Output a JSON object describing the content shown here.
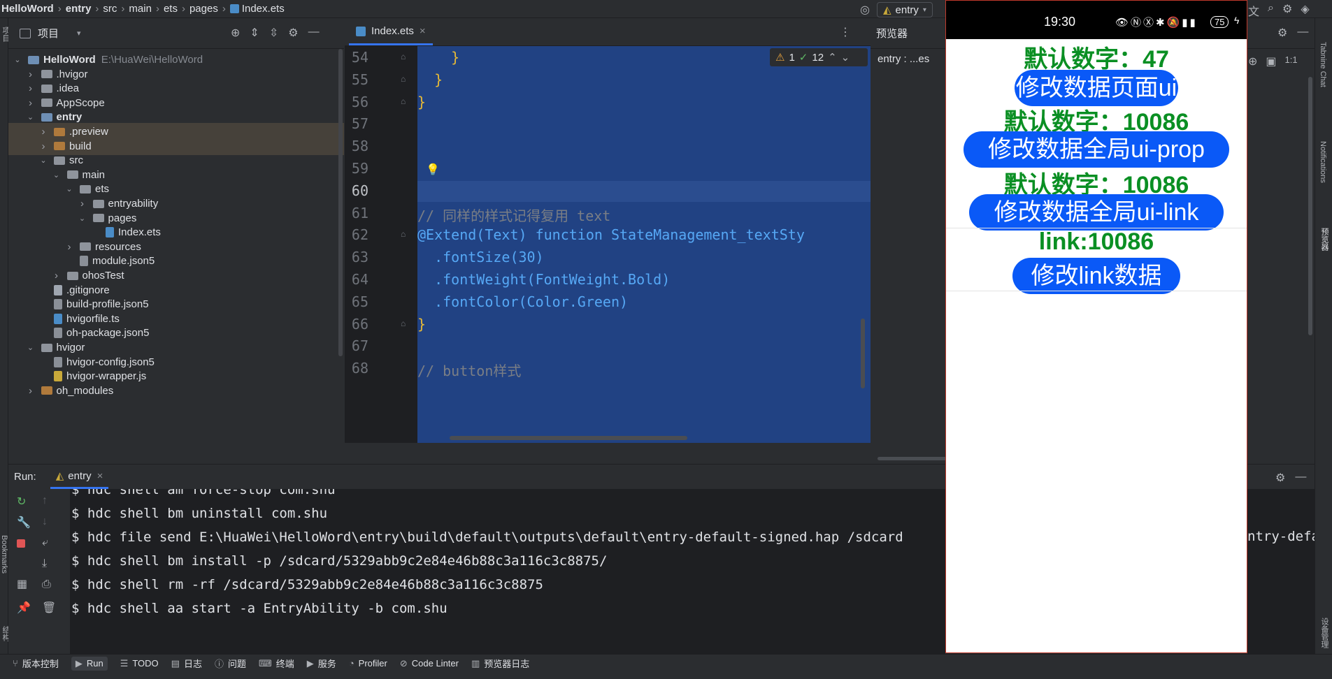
{
  "breadcrumb": [
    "HelloWord",
    "entry",
    "src",
    "main",
    "ets",
    "pages",
    "Index.ets"
  ],
  "run_config": "entry",
  "project_panel": {
    "title": "项目",
    "tree": [
      {
        "label": "HelloWord",
        "path": "E:\\HuaWei\\HelloWord",
        "level": 0,
        "expanded": true,
        "kind": "module",
        "bold": true
      },
      {
        "label": ".hvigor",
        "level": 1,
        "expanded": false,
        "kind": "folder"
      },
      {
        "label": ".idea",
        "level": 1,
        "expanded": false,
        "kind": "folder"
      },
      {
        "label": "AppScope",
        "level": 1,
        "expanded": false,
        "kind": "folder"
      },
      {
        "label": "entry",
        "level": 1,
        "expanded": true,
        "kind": "module",
        "bold": true
      },
      {
        "label": ".preview",
        "level": 2,
        "expanded": false,
        "kind": "excluded",
        "highlight": true
      },
      {
        "label": "build",
        "level": 2,
        "expanded": false,
        "kind": "excluded",
        "highlight": true
      },
      {
        "label": "src",
        "level": 2,
        "expanded": true,
        "kind": "folder"
      },
      {
        "label": "main",
        "level": 3,
        "expanded": true,
        "kind": "folder"
      },
      {
        "label": "ets",
        "level": 4,
        "expanded": true,
        "kind": "folder"
      },
      {
        "label": "entryability",
        "level": 5,
        "expanded": false,
        "kind": "folder"
      },
      {
        "label": "pages",
        "level": 5,
        "expanded": true,
        "kind": "folder"
      },
      {
        "label": "Index.ets",
        "level": 6,
        "kind": "ts"
      },
      {
        "label": "resources",
        "level": 4,
        "expanded": false,
        "kind": "folder"
      },
      {
        "label": "module.json5",
        "level": 4,
        "kind": "json"
      },
      {
        "label": "ohosTest",
        "level": 3,
        "expanded": false,
        "kind": "folder"
      },
      {
        "label": ".gitignore",
        "level": 2,
        "kind": "file"
      },
      {
        "label": "build-profile.json5",
        "level": 2,
        "kind": "json"
      },
      {
        "label": "hvigorfile.ts",
        "level": 2,
        "kind": "ts"
      },
      {
        "label": "oh-package.json5",
        "level": 2,
        "kind": "json"
      },
      {
        "label": "hvigor",
        "level": 1,
        "expanded": true,
        "kind": "folder"
      },
      {
        "label": "hvigor-config.json5",
        "level": 2,
        "kind": "json"
      },
      {
        "label": "hvigor-wrapper.js",
        "level": 2,
        "kind": "js"
      },
      {
        "label": "oh_modules",
        "level": 1,
        "expanded": false,
        "kind": "excluded"
      }
    ]
  },
  "editor": {
    "tab": "Index.ets",
    "inspections": {
      "warnings": "1",
      "weak_warnings": "12"
    },
    "lines": [
      {
        "n": "54",
        "text": "    }"
      },
      {
        "n": "55",
        "text": "  }"
      },
      {
        "n": "56",
        "text": "}"
      },
      {
        "n": "57",
        "text": ""
      },
      {
        "n": "58",
        "text": ""
      },
      {
        "n": "59",
        "text": ""
      },
      {
        "n": "60",
        "text": ""
      },
      {
        "n": "61",
        "text": "// 同样的样式记得复用 text"
      },
      {
        "n": "62",
        "text": "@Extend(Text) function StateManagement_textSty"
      },
      {
        "n": "63",
        "text": "  .fontSize(30)"
      },
      {
        "n": "64",
        "text": "  .fontWeight(FontWeight.Bold)"
      },
      {
        "n": "65",
        "text": "  .fontColor(Color.Green)"
      },
      {
        "n": "66",
        "text": "}"
      },
      {
        "n": "67",
        "text": ""
      },
      {
        "n": "68",
        "text": "// button样式"
      }
    ],
    "current_line": "60"
  },
  "previewer": {
    "title": "预览器",
    "subtitle": "entry : ...es",
    "phone": {
      "time": "19:30",
      "battery": "75",
      "items": [
        {
          "type": "text",
          "label": "默认数字：47"
        },
        {
          "type": "button",
          "label": "修改数据页面ui"
        },
        {
          "type": "text",
          "label": "默认数字：10086"
        },
        {
          "type": "button",
          "label": "修改数据全局ui-prop"
        },
        {
          "type": "text",
          "label": "默认数字：10086"
        },
        {
          "type": "button",
          "label": "修改数据全局ui-link"
        },
        {
          "type": "text",
          "label": "link:10086"
        },
        {
          "type": "button",
          "label": "修改link数据"
        }
      ]
    }
  },
  "run_panel": {
    "label": "Run:",
    "tab": "entry",
    "console": [
      "$ hdc shell am force-stop com.shu",
      "$ hdc shell bm uninstall com.shu",
      "$ hdc file send E:\\HuaWei\\HelloWord\\entry\\build\\default\\outputs\\default\\entry-default-signed.hap /sdcard",
      "$ hdc shell bm install -p /sdcard/5329abb9c2e84e46b88c3a116c3c8875/",
      "$ hdc shell rm -rf /sdcard/5329abb9c2e84e46b88c3a116c3c8875",
      "$ hdc shell aa start -a EntryAbility -b com.shu"
    ],
    "console_overflow": "ntry-defa"
  },
  "bottom_tools": [
    {
      "label": "版本控制",
      "icon": "branch-icon"
    },
    {
      "label": "Run",
      "icon": "run-icon",
      "active": true
    },
    {
      "label": "TODO",
      "icon": "list-icon"
    },
    {
      "label": "日志",
      "icon": "log-icon"
    },
    {
      "label": "问题",
      "icon": "problems-icon"
    },
    {
      "label": "终端",
      "icon": "terminal-icon"
    },
    {
      "label": "服务",
      "icon": "services-icon"
    },
    {
      "label": "Profiler",
      "icon": "profiler-icon"
    },
    {
      "label": "Code Linter",
      "icon": "linter-icon"
    },
    {
      "label": "预览器日志",
      "icon": "preview-log-icon"
    }
  ],
  "right_strip": [
    "Tabnine Chat",
    "Notifications",
    "预览器",
    "设备管理"
  ],
  "left_strip": [
    "项目",
    "Bookmarks",
    "结构"
  ]
}
